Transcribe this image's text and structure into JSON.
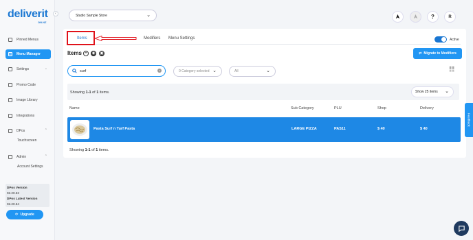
{
  "brand": {
    "name": "deliverit",
    "sub": "ON.NZ"
  },
  "sidebar": {
    "items": [
      {
        "label": "Pinned Menus"
      },
      {
        "label": "Menu Manager"
      },
      {
        "label": "Settings"
      },
      {
        "label": "Promo Code"
      },
      {
        "label": "Image Library"
      },
      {
        "label": "Integrations"
      },
      {
        "label": "DPos"
      },
      {
        "label": "Admin"
      }
    ],
    "sub_items": {
      "dpos": "Touchscreen",
      "admin": "Account Settings"
    },
    "version": {
      "label": "DPos Version",
      "value": "02.20.62",
      "latest_label": "DPos Latest Version",
      "latest_value": "02.20.64"
    },
    "upgrade_label": "Upgrade"
  },
  "header": {
    "store": "Studio Sample Store",
    "user_initial": "R",
    "help": "?"
  },
  "tabs": [
    {
      "label": "Items"
    },
    {
      "label": "Modifiers"
    },
    {
      "label": "Menu Settings"
    }
  ],
  "active_toggle": {
    "label": "Active",
    "on": true
  },
  "items_header": {
    "title": "Items",
    "migrate_label": "Migrate to Modifiers"
  },
  "search": {
    "value": "surf"
  },
  "filters": {
    "category": "0 Category selected",
    "status": "All"
  },
  "showing": {
    "prefix": "Showing ",
    "range": "1-1",
    "of": " of ",
    "total": "1",
    "suffix": " items."
  },
  "page_size": "Show 25 items",
  "table": {
    "columns": [
      "Name",
      "Sub Category",
      "PLU",
      "Shop",
      "Delivery"
    ],
    "rows": [
      {
        "name": "Pasta Surf n Turf Pasta",
        "sub_category": "LARGE PIZZA",
        "plu": "PAS11",
        "shop": "$ 40",
        "delivery": "$ 40"
      }
    ]
  },
  "feedback_label": "Feedback",
  "colors": {
    "primary": "#2196f3",
    "annotation": "#e0121a"
  }
}
